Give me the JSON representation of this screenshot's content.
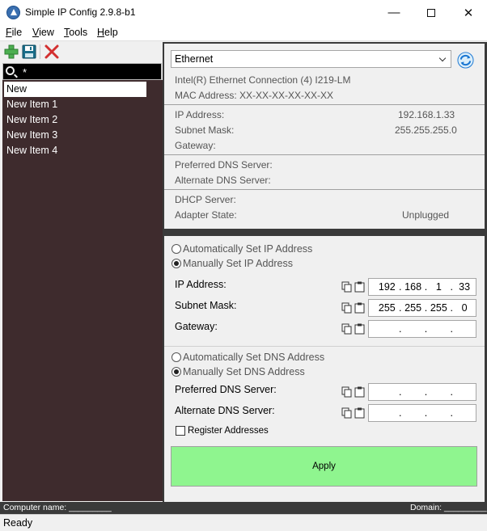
{
  "window": {
    "title": "Simple IP Config 2.9.8-b1"
  },
  "menu": [
    {
      "label": "File",
      "key": "F",
      "rest": "ile"
    },
    {
      "label": "View",
      "key": "V",
      "rest": "iew"
    },
    {
      "label": "Tools",
      "key": "T",
      "rest": "ools"
    },
    {
      "label": "Help",
      "key": "H",
      "rest": "elp"
    }
  ],
  "toolbar": {
    "icons": [
      "add-profile-icon",
      "save-profile-icon",
      "delete-profile-icon"
    ],
    "colors": {
      "add": "#4caf50",
      "save": "#1a6e8a",
      "delete": "#d32f2f"
    }
  },
  "search": {
    "value": "*"
  },
  "profiles": {
    "items": [
      "New",
      "New Item 1",
      "New Item 2",
      "New Item 3",
      "New Item 4"
    ],
    "selected_index": 0
  },
  "adapter": {
    "selected": "Ethernet",
    "description": "Intel(R) Ethernet Connection (4) I219-LM",
    "mac": "MAC Address: XX-XX-XX-XX-XX-XX"
  },
  "current": {
    "ip_label": "IP Address:",
    "ip_value": "192.168.1.33",
    "subnet_label": "Subnet Mask:",
    "subnet_value": "255.255.255.0",
    "gateway_label": "Gateway:",
    "gateway_value": "",
    "dns_pref_label": "Preferred DNS Server:",
    "dns_pref_value": "",
    "dns_alt_label": "Alternate DNS Server:",
    "dns_alt_value": "",
    "dhcp_label": "DHCP Server:",
    "dhcp_value": "",
    "state_label": "Adapter State:",
    "state_value": "Unplugged"
  },
  "config": {
    "ip_auto_label": "Automatically Set IP Address",
    "ip_manual_label": "Manually Set IP Address",
    "ip_mode": "manual",
    "ip_label": "IP Address:",
    "ip": [
      "192",
      "168",
      "1",
      "33"
    ],
    "subnet_label": "Subnet Mask:",
    "subnet": [
      "255",
      "255",
      "255",
      "0"
    ],
    "gateway_label": "Gateway:",
    "gateway": [
      "",
      "",
      "",
      ""
    ],
    "dns_auto_label": "Automatically Set DNS Address",
    "dns_manual_label": "Manually Set DNS Address",
    "dns_mode": "manual",
    "dns_pref_label": "Preferred DNS Server:",
    "dns_pref": [
      "",
      "",
      "",
      ""
    ],
    "dns_alt_label": "Alternate DNS Server:",
    "dns_alt": [
      "",
      "",
      "",
      ""
    ],
    "register_label": "Register Addresses",
    "register_checked": false,
    "apply_label": "Apply",
    "apply_color": "#8ff58f"
  },
  "infobar": {
    "computer_name": "Computer name: _________",
    "domain": "Domain: _________"
  },
  "status": {
    "text": "Ready"
  }
}
